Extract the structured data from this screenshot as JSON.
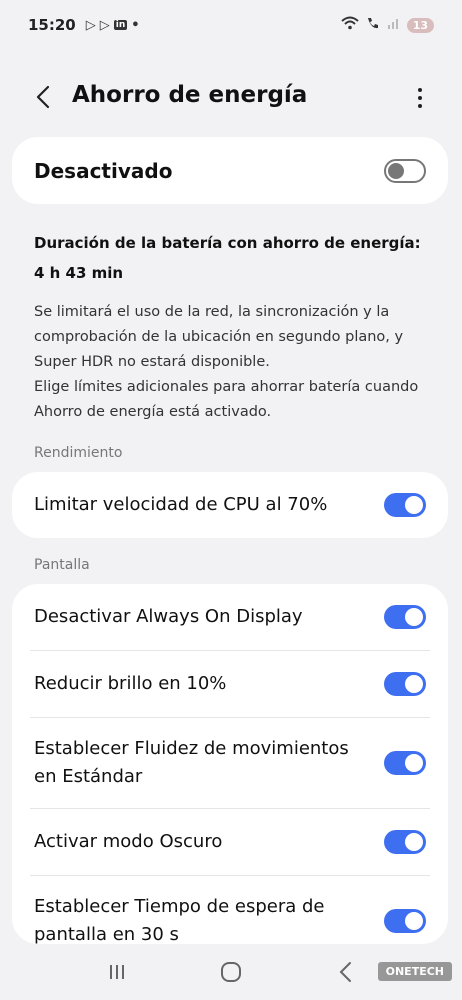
{
  "status_bar": {
    "time": "15:20",
    "battery": "13"
  },
  "header": {
    "title": "Ahorro de energía"
  },
  "master": {
    "label": "Desactivado",
    "enabled": false
  },
  "info": {
    "title": "Duración de la batería con ahorro de energía: 4 h 43 min",
    "description_1": "Se limitará el uso de la red, la sincronización y la comprobación de la ubicación en segundo plano, y Super HDR no estará disponible.",
    "description_2": "Elige límites adicionales para ahorrar batería cuando Ahorro de energía está activado."
  },
  "sections": {
    "performance": "Rendimiento",
    "display": "Pantalla"
  },
  "performance_items": [
    {
      "label": "Limitar velocidad de CPU al 70%",
      "enabled": true
    }
  ],
  "display_items": [
    {
      "label": "Desactivar Always On Display",
      "enabled": true
    },
    {
      "label": "Reducir brillo en 10%",
      "enabled": true
    },
    {
      "label": "Establecer Fluidez de movimientos en Estándar",
      "enabled": true
    },
    {
      "label": "Activar modo Oscuro",
      "enabled": true
    },
    {
      "label": "Establecer Tiempo de espera de pantalla en 30 s",
      "enabled": true
    }
  ],
  "watermark": "ONETECH",
  "colors": {
    "accent": "#3e6ff0",
    "background": "#f2f2f4",
    "card": "#ffffff"
  }
}
